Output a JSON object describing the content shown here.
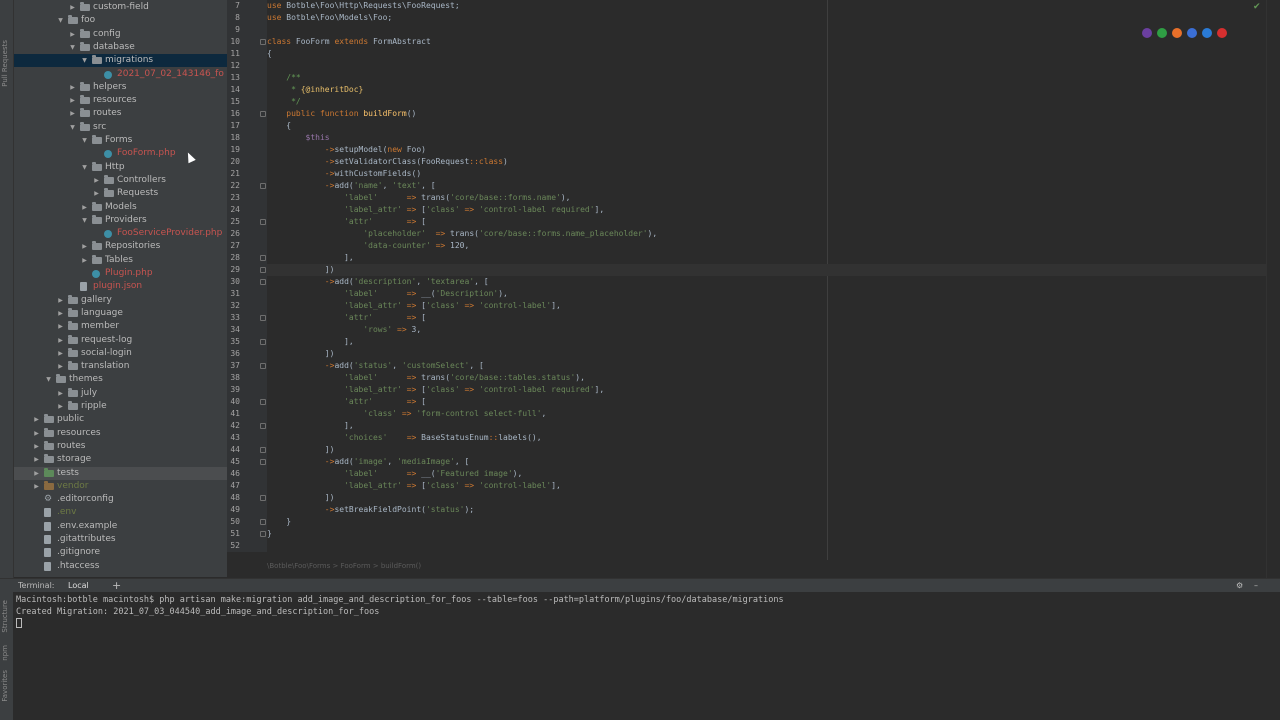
{
  "side_strip": {
    "top_label": "Pull Requests",
    "bottom_labels": [
      "Structure",
      "npm",
      "Favorites"
    ]
  },
  "tree": [
    {
      "label": "custom-field",
      "indent": 4,
      "arrow": "right",
      "icon": "folder"
    },
    {
      "label": "foo",
      "indent": 3,
      "arrow": "down",
      "icon": "folder"
    },
    {
      "label": "config",
      "indent": 4,
      "arrow": "right",
      "icon": "folder"
    },
    {
      "label": "database",
      "indent": 4,
      "arrow": "down",
      "icon": "folder"
    },
    {
      "label": "migrations",
      "indent": 5,
      "arrow": "down",
      "icon": "folder",
      "selected": true
    },
    {
      "label": "2021_07_02_143146_fo",
      "indent": 6,
      "arrow": "",
      "icon": "php",
      "style": "red"
    },
    {
      "label": "helpers",
      "indent": 4,
      "arrow": "right",
      "icon": "folder"
    },
    {
      "label": "resources",
      "indent": 4,
      "arrow": "right",
      "icon": "folder"
    },
    {
      "label": "routes",
      "indent": 4,
      "arrow": "right",
      "icon": "folder"
    },
    {
      "label": "src",
      "indent": 4,
      "arrow": "down",
      "icon": "folder"
    },
    {
      "label": "Forms",
      "indent": 5,
      "arrow": "down",
      "icon": "folder"
    },
    {
      "label": "FooForm.php",
      "indent": 6,
      "arrow": "",
      "icon": "php",
      "style": "red"
    },
    {
      "label": "Http",
      "indent": 5,
      "arrow": "down",
      "icon": "folder"
    },
    {
      "label": "Controllers",
      "indent": 6,
      "arrow": "right",
      "icon": "folder"
    },
    {
      "label": "Requests",
      "indent": 6,
      "arrow": "right",
      "icon": "folder"
    },
    {
      "label": "Models",
      "indent": 5,
      "arrow": "right",
      "icon": "folder"
    },
    {
      "label": "Providers",
      "indent": 5,
      "arrow": "down",
      "icon": "folder"
    },
    {
      "label": "FooServiceProvider.php",
      "indent": 6,
      "arrow": "",
      "icon": "php",
      "style": "red"
    },
    {
      "label": "Repositories",
      "indent": 5,
      "arrow": "right",
      "icon": "folder"
    },
    {
      "label": "Tables",
      "indent": 5,
      "arrow": "right",
      "icon": "folder"
    },
    {
      "label": "Plugin.php",
      "indent": 5,
      "arrow": "",
      "icon": "php",
      "style": "red"
    },
    {
      "label": "plugin.json",
      "indent": 4,
      "arrow": "",
      "icon": "file",
      "style": "red"
    },
    {
      "label": "gallery",
      "indent": 3,
      "arrow": "right",
      "icon": "folder"
    },
    {
      "label": "language",
      "indent": 3,
      "arrow": "right",
      "icon": "folder"
    },
    {
      "label": "member",
      "indent": 3,
      "arrow": "right",
      "icon": "folder"
    },
    {
      "label": "request-log",
      "indent": 3,
      "arrow": "right",
      "icon": "folder"
    },
    {
      "label": "social-login",
      "indent": 3,
      "arrow": "right",
      "icon": "folder"
    },
    {
      "label": "translation",
      "indent": 3,
      "arrow": "right",
      "icon": "folder"
    },
    {
      "label": "themes",
      "indent": 2,
      "arrow": "down",
      "icon": "folder"
    },
    {
      "label": "july",
      "indent": 3,
      "arrow": "right",
      "icon": "folder"
    },
    {
      "label": "ripple",
      "indent": 3,
      "arrow": "right",
      "icon": "folder"
    },
    {
      "label": "public",
      "indent": 1,
      "arrow": "right",
      "icon": "folder"
    },
    {
      "label": "resources",
      "indent": 1,
      "arrow": "right",
      "icon": "folder"
    },
    {
      "label": "routes",
      "indent": 1,
      "arrow": "right",
      "icon": "folder"
    },
    {
      "label": "storage",
      "indent": 1,
      "arrow": "right",
      "icon": "folder"
    },
    {
      "label": "tests",
      "indent": 1,
      "arrow": "right",
      "icon": "folder-green",
      "selectedGray": true
    },
    {
      "label": "vendor",
      "indent": 1,
      "arrow": "right",
      "icon": "folder-brown",
      "style": "dim"
    },
    {
      "label": ".editorconfig",
      "indent": 1,
      "arrow": "",
      "icon": "gear"
    },
    {
      "label": ".env",
      "indent": 1,
      "arrow": "",
      "icon": "file",
      "style": "dim"
    },
    {
      "label": ".env.example",
      "indent": 1,
      "arrow": "",
      "icon": "file"
    },
    {
      "label": ".gitattributes",
      "indent": 1,
      "arrow": "",
      "icon": "file"
    },
    {
      "label": ".gitignore",
      "indent": 1,
      "arrow": "",
      "icon": "file"
    },
    {
      "label": ".htaccess",
      "indent": 1,
      "arrow": "",
      "icon": "file"
    }
  ],
  "editor": {
    "lines": [
      {
        "n": "7",
        "parts": [
          [
            "kw",
            "use "
          ],
          [
            "",
            "Botble\\Foo\\Http\\Requests\\FooRequest;"
          ]
        ]
      },
      {
        "n": "8",
        "parts": [
          [
            "kw",
            "use "
          ],
          [
            "",
            "Botble\\Foo\\Models\\Foo;"
          ]
        ]
      },
      {
        "n": "9",
        "parts": []
      },
      {
        "n": "10",
        "parts": [
          [
            "kw",
            "class "
          ],
          [
            "",
            "FooForm "
          ],
          [
            "kw",
            "extends "
          ],
          [
            "",
            "FormAbstract"
          ]
        ]
      },
      {
        "n": "11",
        "parts": [
          [
            "",
            "{"
          ]
        ]
      },
      {
        "n": "12",
        "parts": []
      },
      {
        "n": "13",
        "parts": [
          [
            "cm",
            "    /**"
          ]
        ]
      },
      {
        "n": "14",
        "parts": [
          [
            "cm",
            "     * "
          ],
          [
            "cl",
            "{@inheritDoc}"
          ]
        ]
      },
      {
        "n": "15",
        "parts": [
          [
            "cm",
            "     */"
          ]
        ]
      },
      {
        "n": "16",
        "parts": [
          [
            "kw",
            "    public function "
          ],
          [
            "fn",
            "buildForm"
          ],
          [
            "",
            "()"
          ]
        ]
      },
      {
        "n": "17",
        "parts": [
          [
            "",
            "    {"
          ]
        ]
      },
      {
        "n": "18",
        "parts": [
          [
            "var",
            "        $this"
          ]
        ]
      },
      {
        "n": "19",
        "parts": [
          [
            "kw",
            "            ->"
          ],
          [
            "",
            "setupModel("
          ],
          [
            "kw",
            "new "
          ],
          [
            "",
            "Foo)"
          ]
        ]
      },
      {
        "n": "20",
        "parts": [
          [
            "kw",
            "            ->"
          ],
          [
            "",
            "setValidatorClass(FooRequest"
          ],
          [
            "kw",
            "::class"
          ],
          [
            "",
            ")"
          ]
        ]
      },
      {
        "n": "21",
        "parts": [
          [
            "kw",
            "            ->"
          ],
          [
            "",
            "withCustomFields()"
          ]
        ]
      },
      {
        "n": "22",
        "parts": [
          [
            "kw",
            "            ->"
          ],
          [
            "",
            "add("
          ],
          [
            "st",
            "'name'"
          ],
          [
            "",
            ", "
          ],
          [
            "st",
            "'text'"
          ],
          [
            "",
            ", ["
          ]
        ]
      },
      {
        "n": "23",
        "parts": [
          [
            "st",
            "                'label'"
          ],
          [
            "kw",
            "      => "
          ],
          [
            "",
            "trans("
          ],
          [
            "st",
            "'core/base::forms.name'"
          ],
          [
            "",
            "),"
          ]
        ]
      },
      {
        "n": "24",
        "parts": [
          [
            "st",
            "                'label_attr'"
          ],
          [
            "kw",
            " => "
          ],
          [
            "",
            "["
          ],
          [
            "st",
            "'class'"
          ],
          [
            "kw",
            " => "
          ],
          [
            "st",
            "'control-label required'"
          ],
          [
            "",
            "],"
          ]
        ]
      },
      {
        "n": "25",
        "parts": [
          [
            "st",
            "                'attr'"
          ],
          [
            "kw",
            "       => "
          ],
          [
            "",
            "["
          ]
        ]
      },
      {
        "n": "26",
        "parts": [
          [
            "st",
            "                    'placeholder'"
          ],
          [
            "kw",
            "  => "
          ],
          [
            "",
            "trans("
          ],
          [
            "st",
            "'core/base::forms.name_placeholder'"
          ],
          [
            "",
            "),"
          ]
        ]
      },
      {
        "n": "27",
        "parts": [
          [
            "st",
            "                    'data-counter'"
          ],
          [
            "kw",
            " => "
          ],
          [
            "",
            "120,"
          ]
        ]
      },
      {
        "n": "28",
        "parts": [
          [
            "",
            "                ],"
          ]
        ]
      },
      {
        "n": "29",
        "parts": [
          [
            "",
            "            ])"
          ]
        ],
        "cur": true
      },
      {
        "n": "30",
        "parts": [
          [
            "kw",
            "            ->"
          ],
          [
            "",
            "add("
          ],
          [
            "st",
            "'description'"
          ],
          [
            "",
            ", "
          ],
          [
            "st",
            "'textarea'"
          ],
          [
            "",
            ", ["
          ]
        ]
      },
      {
        "n": "31",
        "parts": [
          [
            "st",
            "                'label'"
          ],
          [
            "kw",
            "      => "
          ],
          [
            "",
            "__("
          ],
          [
            "st",
            "'Description'"
          ],
          [
            "",
            "),"
          ]
        ]
      },
      {
        "n": "32",
        "parts": [
          [
            "st",
            "                'label_attr'"
          ],
          [
            "kw",
            " => "
          ],
          [
            "",
            "["
          ],
          [
            "st",
            "'class'"
          ],
          [
            "kw",
            " => "
          ],
          [
            "st",
            "'control-label'"
          ],
          [
            "",
            "],"
          ]
        ]
      },
      {
        "n": "33",
        "parts": [
          [
            "st",
            "                'attr'"
          ],
          [
            "kw",
            "       => "
          ],
          [
            "",
            "["
          ]
        ]
      },
      {
        "n": "34",
        "parts": [
          [
            "st",
            "                    'rows'"
          ],
          [
            "kw",
            " => "
          ],
          [
            "",
            "3,"
          ]
        ]
      },
      {
        "n": "35",
        "parts": [
          [
            "",
            "                ],"
          ]
        ]
      },
      {
        "n": "36",
        "parts": [
          [
            "",
            "            ])"
          ]
        ]
      },
      {
        "n": "37",
        "parts": [
          [
            "kw",
            "            ->"
          ],
          [
            "",
            "add("
          ],
          [
            "st",
            "'status'"
          ],
          [
            "",
            ", "
          ],
          [
            "st",
            "'customSelect'"
          ],
          [
            "",
            ", ["
          ]
        ]
      },
      {
        "n": "38",
        "parts": [
          [
            "st",
            "                'label'"
          ],
          [
            "kw",
            "      => "
          ],
          [
            "",
            "trans("
          ],
          [
            "st",
            "'core/base::tables.status'"
          ],
          [
            "",
            "),"
          ]
        ]
      },
      {
        "n": "39",
        "parts": [
          [
            "st",
            "                'label_attr'"
          ],
          [
            "kw",
            " => "
          ],
          [
            "",
            "["
          ],
          [
            "st",
            "'class'"
          ],
          [
            "kw",
            " => "
          ],
          [
            "st",
            "'control-label required'"
          ],
          [
            "",
            "],"
          ]
        ]
      },
      {
        "n": "40",
        "parts": [
          [
            "st",
            "                'attr'"
          ],
          [
            "kw",
            "       => "
          ],
          [
            "",
            "["
          ]
        ]
      },
      {
        "n": "41",
        "parts": [
          [
            "st",
            "                    'class'"
          ],
          [
            "kw",
            " => "
          ],
          [
            "st",
            "'form-control select-full'"
          ],
          [
            "",
            ","
          ]
        ]
      },
      {
        "n": "42",
        "parts": [
          [
            "",
            "                ],"
          ]
        ]
      },
      {
        "n": "43",
        "parts": [
          [
            "st",
            "                'choices'"
          ],
          [
            "kw",
            "    => "
          ],
          [
            "",
            "BaseStatusEnum"
          ],
          [
            "kw",
            "::"
          ],
          [
            "",
            "labels(),"
          ]
        ]
      },
      {
        "n": "44",
        "parts": [
          [
            "",
            "            ])"
          ]
        ]
      },
      {
        "n": "45",
        "parts": [
          [
            "kw",
            "            ->"
          ],
          [
            "",
            "add("
          ],
          [
            "st",
            "'image'"
          ],
          [
            "",
            ", "
          ],
          [
            "st",
            "'mediaImage'"
          ],
          [
            "",
            ", ["
          ]
        ]
      },
      {
        "n": "46",
        "parts": [
          [
            "st",
            "                'label'"
          ],
          [
            "kw",
            "      => "
          ],
          [
            "",
            "__("
          ],
          [
            "st",
            "'Featured image'"
          ],
          [
            "",
            "),"
          ]
        ]
      },
      {
        "n": "47",
        "parts": [
          [
            "st",
            "                'label_attr'"
          ],
          [
            "kw",
            " => "
          ],
          [
            "",
            "["
          ],
          [
            "st",
            "'class'"
          ],
          [
            "kw",
            " => "
          ],
          [
            "st",
            "'control-label'"
          ],
          [
            "",
            "],"
          ]
        ]
      },
      {
        "n": "48",
        "parts": [
          [
            "",
            "            ])"
          ]
        ]
      },
      {
        "n": "49",
        "parts": [
          [
            "kw",
            "            ->"
          ],
          [
            "",
            "setBreakFieldPoint("
          ],
          [
            "st",
            "'status'"
          ],
          [
            "",
            ");"
          ]
        ]
      },
      {
        "n": "50",
        "parts": [
          [
            "",
            "    }"
          ]
        ]
      },
      {
        "n": "51",
        "parts": [
          [
            "",
            "}"
          ]
        ]
      },
      {
        "n": "52",
        "parts": []
      }
    ]
  },
  "breadcrumb": "\\Botble\\Foo\\Forms  >  FooForm  >  buildForm()",
  "terminal": {
    "tab_title": "Terminal:",
    "tab_local": "Local",
    "add": "+",
    "line1": "Macintosh:botble macintosh$ php artisan make:migration add_image_and_description_for_foos --table=foos --path=platform/plugins/foo/database/migrations",
    "line2": "Created Migration: 2021_07_03_044540_add_image_and_description_for_foos"
  },
  "colors": {
    "keyword": "#cc7832",
    "string": "#6a8759",
    "variable": "#9876aa",
    "function": "#ffc66d",
    "comment": "#629755"
  }
}
